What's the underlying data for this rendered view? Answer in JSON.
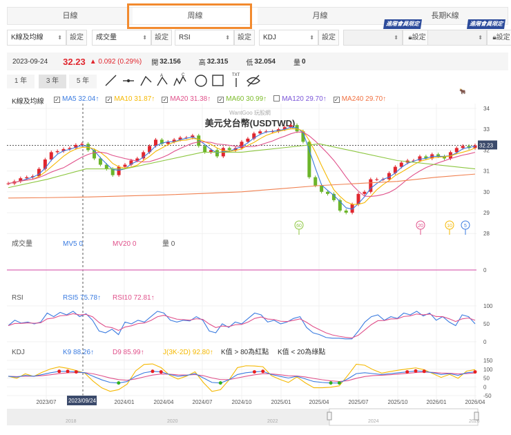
{
  "tabs": [
    "日線",
    "周線",
    "月線",
    "長期K線"
  ],
  "selectors": [
    {
      "value": "K線及均線",
      "btn": "設定"
    },
    {
      "value": "成交量",
      "btn": "設定"
    },
    {
      "value": "RSI",
      "btn": "設定"
    },
    {
      "value": "KDJ",
      "btn": "設定"
    },
    {
      "value": "",
      "btn": "設定",
      "locked": true
    },
    {
      "value": "",
      "btn": "設定",
      "locked": true
    }
  ],
  "premium_badge": "進階會員限定",
  "info": {
    "date": "2023-09-24",
    "price": "32.23",
    "change": "▲ 0.092 (0.29%)",
    "open_label": "開",
    "open": "32.156",
    "high_label": "高",
    "high": "32.315",
    "low_label": "低",
    "low": "32.054",
    "vol_label": "量",
    "vol": "0"
  },
  "ranges": [
    "1 年",
    "3 年",
    "5 年"
  ],
  "legend": {
    "title": "K線及均線",
    "items": [
      {
        "label": "MA5 32.04↑",
        "color": "#3a7be0",
        "checked": true
      },
      {
        "label": "MA10 31.87↑",
        "color": "#f5b800",
        "checked": true
      },
      {
        "label": "MA20 31.38↑",
        "color": "#e0508a",
        "checked": true
      },
      {
        "label": "MA60 30.99↑",
        "color": "#7cbb2a",
        "checked": true
      },
      {
        "label": "MA120 29.70↑",
        "color": "#7a55d8",
        "checked": false
      },
      {
        "label": "MA240 29.70↑",
        "color": "#f07040",
        "checked": true
      }
    ]
  },
  "watermark": "WantGoo 玩股網",
  "chart_title": "美元兌台幣(USDTWD)",
  "current_price_tag": "32.23",
  "price_ticks": [
    "34",
    "33",
    "32",
    "31",
    "30",
    "29",
    "28"
  ],
  "ma_markers": [
    "60",
    "20",
    "10",
    "5"
  ],
  "volume": {
    "title": "成交量",
    "mv5": "MV5 0",
    "mv20": "MV20 0",
    "vol": "量 0",
    "tick": "0"
  },
  "rsi": {
    "title": "RSI",
    "rsi5": "RSI5 75.78↑",
    "rsi10": "RSI10 72.81↑",
    "ticks": [
      "100",
      "50",
      "0"
    ]
  },
  "kdj": {
    "title": "KDJ",
    "k": "K9 88.26↑",
    "d": "D9 85.99↑",
    "j": "J(3K-2D) 92.80↑",
    "note_red": "K值 > 80為紅點",
    "note_green": "K值 < 20為綠點",
    "ticks": [
      "150",
      "100",
      "50",
      "0",
      "-50"
    ]
  },
  "x_labels": [
    "2023/07",
    "2024/01",
    "2024/04",
    "2024/07",
    "2024/10",
    "2025/01",
    "2025/04",
    "2025/07",
    "2025/10",
    "2026/01",
    "2026/04"
  ],
  "crosshair_date": "2023/09/24",
  "navigator_labels": [
    "2018",
    "2020",
    "2022",
    "2024",
    "2026"
  ],
  "chart_data": {
    "type": "line",
    "title": "美元兌台幣(USDTWD)",
    "ylim": [
      28,
      34
    ],
    "close": [
      30.4,
      30.5,
      30.65,
      30.7,
      30.75,
      31.1,
      31.55,
      31.9,
      31.95,
      32.05,
      32.1,
      32.25,
      32.3,
      32.0,
      31.6,
      31.3,
      31.1,
      30.8,
      31.2,
      31.3,
      31.5,
      31.6,
      31.9,
      32.2,
      32.5,
      32.3,
      32.4,
      32.5,
      32.6,
      32.6,
      32.7,
      32.2,
      31.9,
      32.0,
      31.7,
      32.1,
      32.0,
      32.1,
      32.4,
      32.55,
      32.8,
      32.9,
      32.9,
      32.9,
      33.0,
      33.1,
      33.2,
      32.9,
      32.4,
      30.7,
      30.3,
      30.0,
      29.9,
      29.6,
      29.1,
      29.0,
      29.4,
      29.9,
      30.0,
      30.6,
      30.6,
      30.6,
      30.9,
      31.2,
      31.4,
      31.5,
      31.5,
      31.7,
      31.6,
      31.8,
      31.7,
      31.6,
      31.9,
      32.1,
      32.2,
      32.1,
      32.23
    ],
    "ma60": [
      30.2,
      30.6,
      31.1,
      31.1,
      31.5,
      31.9,
      31.9,
      32.1,
      32.3,
      31.9,
      31.5,
      31.3,
      31.1
    ],
    "ma240": [
      29.7,
      29.72,
      29.75,
      29.8,
      29.85,
      29.92,
      30.0,
      30.15,
      30.3,
      30.4,
      30.5,
      30.7,
      30.85
    ],
    "rsi5": [
      45,
      60,
      52,
      55,
      50,
      55,
      80,
      70,
      82,
      75,
      85,
      70,
      78,
      60,
      30,
      25,
      35,
      20,
      55,
      50,
      60,
      55,
      70,
      85,
      80,
      60,
      55,
      60,
      58,
      70,
      60,
      30,
      25,
      50,
      40,
      55,
      50,
      65,
      80,
      75,
      55,
      60,
      50,
      55,
      65,
      70,
      40,
      25,
      20,
      12,
      10,
      10,
      8,
      8,
      30,
      55,
      70,
      75,
      60,
      70,
      65,
      80,
      75,
      85,
      72,
      80,
      60,
      70,
      55,
      45,
      75,
      70,
      50
    ],
    "k": [
      60,
      55,
      65,
      60,
      70,
      80,
      88,
      88,
      85,
      80,
      60,
      40,
      25,
      22,
      30,
      60,
      80,
      88,
      85,
      70,
      60,
      65,
      75,
      50,
      25,
      22,
      40,
      70,
      80,
      85,
      88,
      70,
      60,
      50,
      60,
      45,
      30,
      25,
      22,
      22,
      45,
      75,
      80,
      75,
      70,
      75,
      80,
      85,
      90,
      88,
      80,
      70,
      75,
      65,
      80,
      85
    ]
  }
}
